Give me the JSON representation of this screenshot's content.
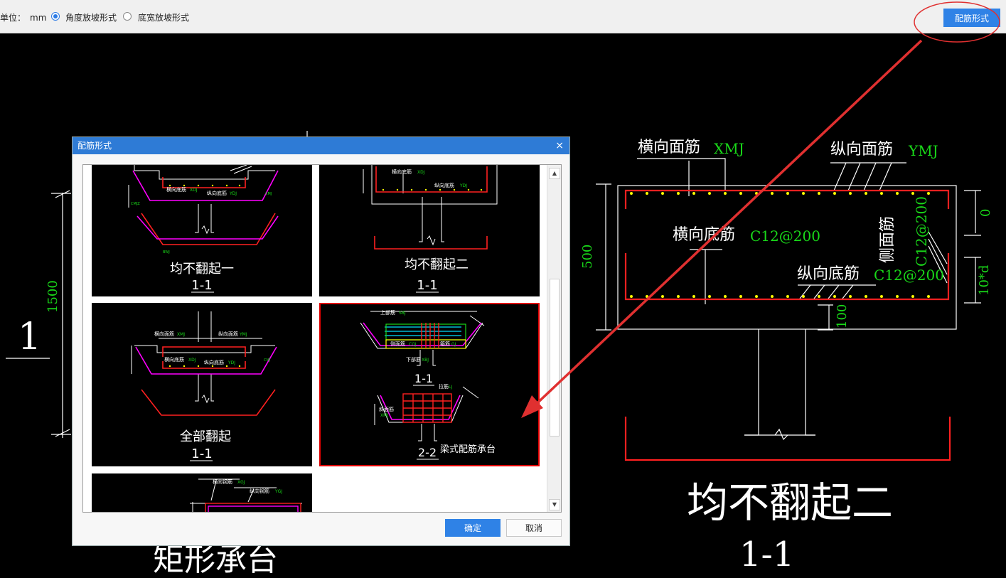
{
  "toolbar": {
    "unit_label": "单位：",
    "unit_value": "mm",
    "radio_angle_label": "角度放坡形式",
    "radio_width_label": "底宽放坡形式",
    "selected": "angle",
    "rebar_form_button": "配筋形式"
  },
  "cad": {
    "left_number": "1",
    "left_dim": "1500",
    "left_bottom_text": "矩形承台",
    "detail": {
      "top_x_label": "横向面筋",
      "top_x_code": "XMJ",
      "top_y_label": "纵向面筋",
      "top_y_code": "YMJ",
      "bottom_x_label": "横向底筋",
      "bottom_x_code": "C12@200",
      "bottom_y_label": "纵向底筋",
      "bottom_y_code": "C12@200",
      "side_label": "侧面筋",
      "side_code": "C12@200",
      "dim_height": "500",
      "dim_top": "0",
      "dim_side": "10*d",
      "dim_bottom": "100",
      "title": "均不翻起二",
      "section": "1-1"
    }
  },
  "dialog": {
    "title": "配筋形式",
    "close_glyph": "×",
    "tiles": [
      {
        "title": "均不翻起一",
        "section": "1-1",
        "labels": {
          "top_rebar": "横向面筋",
          "bottom_x": "横向底筋",
          "bottom_y": "纵向底筋",
          "code_bottom_x": "XDJ",
          "code_bottom_y": "YDJ",
          "code_top_y": "YMJ",
          "code_side": "CMJ",
          "code_slope": "XPJ",
          "code_bend": "BWJ",
          "code_top_bend": "CMJZ"
        }
      },
      {
        "title": "均不翻起二",
        "section": "1-1",
        "labels": {
          "bottom_x": "横向底筋",
          "bottom_y": "纵向底筋",
          "code_bottom_x": "XDJ",
          "code_bottom_y": "YDJ"
        }
      },
      {
        "title": "全部翻起",
        "section": "1-1",
        "labels": {
          "top_x": "横向面筋",
          "top_y": "纵向面筋",
          "bottom_x": "横向底筋",
          "bottom_y": "纵向底筋",
          "code_top_x": "XMJ",
          "code_top_y": "YMJ",
          "code_bottom_x": "XDJ",
          "code_bottom_y": "YDJ",
          "code_side": "CMJ"
        }
      },
      {
        "title": "梁式配筋承台",
        "section_a": "1-1",
        "section_b": "2-2",
        "labels": {
          "upper": "上部筋",
          "code_upper": "SBJ",
          "side": "侧面筋",
          "code_side": "CGJ",
          "stirrup": "箍筋",
          "code_stirrup": "GJ",
          "lower": "下部筋",
          "code_lower": "XBJ",
          "tie": "拉筋",
          "code_tie": "LJ",
          "slope": "斜面筋",
          "code_slope": "XMJ"
        }
      },
      {
        "title": "",
        "section": "",
        "labels": {
          "top_x": "横向钢筋",
          "top_y": "纵向钢筋",
          "code_top_x": "XGJ",
          "code_top_y": "YGJ"
        }
      }
    ],
    "ok_button": "确定",
    "cancel_button": "取消",
    "scroll_up": "▲",
    "scroll_down": "▼"
  },
  "colors": {
    "cad_background": "#000000",
    "rebar_red": "#ff2020",
    "annotation_green": "#19d819",
    "dot_yellow": "#ffff00",
    "accent_blue": "#2f82e6",
    "highlight_red": "#e03030",
    "magenta": "#ff00ff"
  }
}
